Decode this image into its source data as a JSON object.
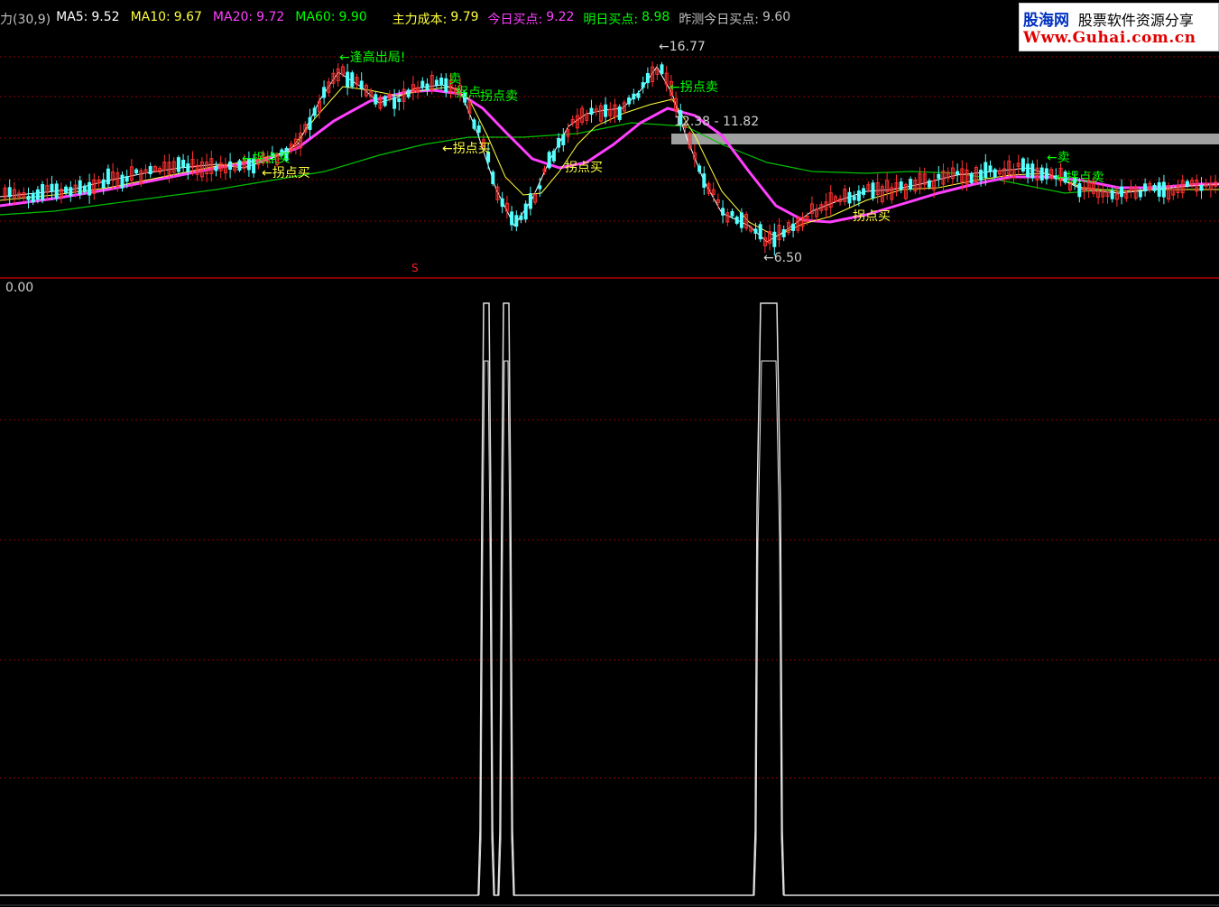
{
  "header": {
    "indicator": "力(30,9)",
    "ma5_label": "MA5:",
    "ma5_value": "9.52",
    "ma10_label": "MA10:",
    "ma10_value": "9.67",
    "ma20_label": "MA20:",
    "ma20_value": "9.72",
    "ma60_label": "MA60:",
    "ma60_value": "9.90",
    "cost_label": "主力成本:",
    "cost_value": "9.79",
    "today_buy_label": "今日买点:",
    "today_buy_value": "9.22",
    "tomorrow_buy_label": "明日买点:",
    "tomorrow_buy_value": "8.98",
    "yesterday_label": "昨测今日买点:",
    "yesterday_value": "9.60"
  },
  "watermark": {
    "brand": "股海网",
    "slogan": "股票软件资源分享",
    "url": "Www.Guhai.com.cn"
  },
  "annotations": {
    "high_exit": "←逢高出局!",
    "sell_1": "卖",
    "turn_sell_1": "拐点卖",
    "turn_buy_1": "←拐点买",
    "turn_buy_2": "←拐点买",
    "turn_buy_3": "拐点买",
    "buy_1": "←拐点买",
    "turn_sell_2": "←拐点卖",
    "sell_2": "←卖",
    "turn_sell_3": "←拐点卖",
    "turn_buy_4": "拐点买",
    "turn_right": "拐点",
    "price_high": "←16.77",
    "price_low": "←6.50",
    "range_text": "12.38 - 11.82",
    "s_marker": "S"
  },
  "lower_panel": {
    "value_label": "0.00"
  },
  "colors": {
    "background": "#000000",
    "grid": "#8b0000",
    "up_candle": "#ff3030",
    "down_candle": "#54ffff",
    "ma5": "#ffffff",
    "ma10": "#ffff00",
    "ma20": "#ff40ff",
    "ma60": "#00c000",
    "annotation_green": "#00ff00",
    "annotation_yellow": "#ffff40",
    "signal_line": "#ffffff"
  }
}
